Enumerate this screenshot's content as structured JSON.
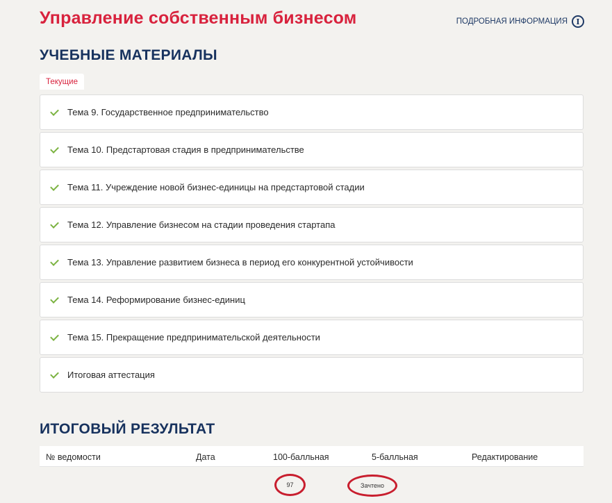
{
  "header": {
    "course_title": "Управление собственным бизнесом",
    "info_link": "ПОДРОБНАЯ ИНФОРМАЦИЯ",
    "info_icon": "info-circle-icon"
  },
  "materials": {
    "title": "УЧЕБНЫЕ МАТЕРИАЛЫ",
    "tab_current": "Текущие",
    "topics": [
      "Тема 9. Государственное предпринимательство",
      "Тема 10. Предстартовая стадия в предпринимательстве",
      "Тема 11. Учреждение новой бизнес-единицы на предстартовой стадии",
      "Тема 12. Управление бизнесом на стадии проведения стартапа",
      "Тема 13. Управление развитием бизнеса в период его конкурентной устойчивости",
      "Тема 14. Реформирование бизнес-единиц",
      "Тема 15. Прекращение предпринимательской деятельности",
      "Итоговая аттестация"
    ]
  },
  "result": {
    "title": "ИТОГОВЫЙ РЕЗУЛЬТАТ",
    "columns": [
      "№ ведомости",
      "Дата",
      "100-балльная",
      "5-балльная",
      "Редактирование"
    ],
    "row": {
      "score_100": "97",
      "score_5": "Зачтено"
    }
  },
  "colors": {
    "accent_red": "#d8223d",
    "heading_navy": "#17325e",
    "check_green": "#7cb342",
    "circle_mark": "#c81e2e"
  }
}
